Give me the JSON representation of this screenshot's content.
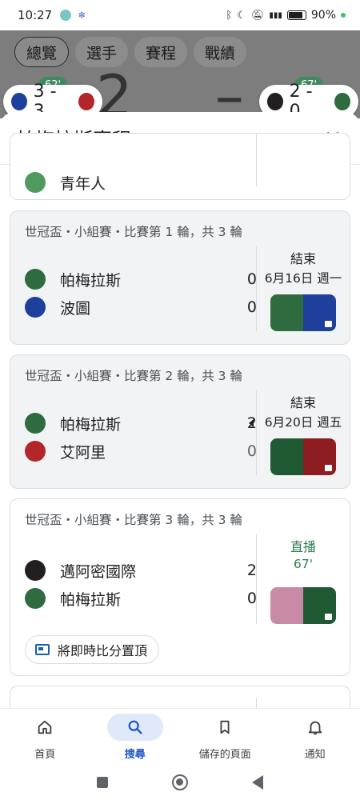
{
  "status_bar": {
    "time": "10:27",
    "battery": "90%"
  },
  "background": {
    "tabs": [
      "總覽",
      "選手",
      "賽程",
      "戰績"
    ],
    "score_text": "2 – 0",
    "left_minute": "62'",
    "left_score": "3 - 3",
    "right_minute": "67'",
    "right_score": "2 - 0"
  },
  "sheet": {
    "title": "帕梅拉斯賽程",
    "close_label": "×",
    "partial_team": "青年人"
  },
  "matches": [
    {
      "header": "世冠盃・小組賽・比賽第 1 輪，共 3 輪",
      "status": "結束",
      "date": "6月16日 週一",
      "teams": [
        {
          "name": "帕梅拉斯",
          "score": "0"
        },
        {
          "name": "波圖",
          "score": "0"
        }
      ]
    },
    {
      "header": "世冠盃・小組賽・比賽第 2 輪，共 3 輪",
      "status": "結束",
      "date": "6月20日 週五",
      "teams": [
        {
          "name": "帕梅拉斯",
          "score": "2"
        },
        {
          "name": "艾阿里",
          "score": "0"
        }
      ]
    },
    {
      "header": "世冠盃・小組賽・比賽第 3 輪，共 3 輪",
      "status": "直播",
      "date": "67'",
      "teams": [
        {
          "name": "邁阿密國際",
          "score": "2"
        },
        {
          "name": "帕梅拉斯",
          "score": "0"
        }
      ],
      "pin_label": "將即時比分置頂"
    }
  ],
  "colors": {
    "palmeiras": "#2e6b3e",
    "porto": "#1e3f9c",
    "ahly": "#b3262a",
    "inter_miami": "#231f20",
    "live_green": "#2e7d4f",
    "active_nav": "#1a56c4"
  },
  "bottom_nav": [
    {
      "label": "首頁",
      "icon": "home-icon"
    },
    {
      "label": "搜尋",
      "icon": "search-icon"
    },
    {
      "label": "儲存的頁面",
      "icon": "bookmark-icon"
    },
    {
      "label": "通知",
      "icon": "bell-icon"
    }
  ]
}
